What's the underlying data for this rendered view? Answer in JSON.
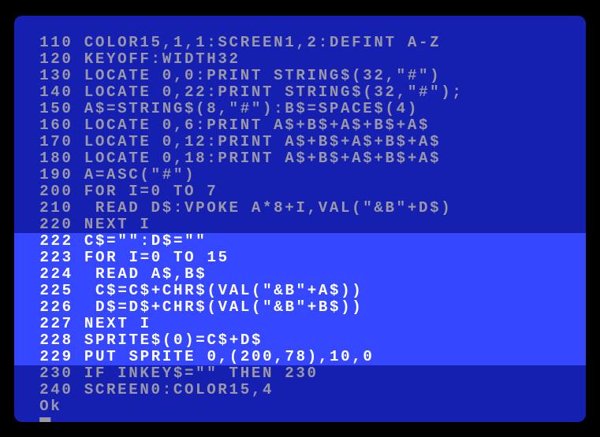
{
  "terminal": {
    "lines": [
      {
        "text": " 110 COLOR15,1,1:SCREEN1,2:DEFINT A-Z",
        "highlight": false
      },
      {
        "text": " 120 KEYOFF:WIDTH32",
        "highlight": false
      },
      {
        "text": " 130 LOCATE 0,0:PRINT STRING$(32,\"#\")",
        "highlight": false
      },
      {
        "text": " 140 LOCATE 0,22:PRINT STRING$(32,\"#\");",
        "highlight": false
      },
      {
        "text": " 150 A$=STRING$(8,\"#\"):B$=SPACE$(4)",
        "highlight": false
      },
      {
        "text": " 160 LOCATE 0,6:PRINT A$+B$+A$+B$+A$",
        "highlight": false
      },
      {
        "text": " 170 LOCATE 0,12:PRINT A$+B$+A$+B$+A$",
        "highlight": false
      },
      {
        "text": " 180 LOCATE 0,18:PRINT A$+B$+A$+B$+A$",
        "highlight": false
      },
      {
        "text": " 190 A=ASC(\"#\")",
        "highlight": false
      },
      {
        "text": " 200 FOR I=0 TO 7",
        "highlight": false
      },
      {
        "text": " 210  READ D$:VPOKE A*8+I,VAL(\"&B\"+D$)",
        "highlight": false
      },
      {
        "text": " 220 NEXT I",
        "highlight": false
      },
      {
        "text": " 222 C$=\"\":D$=\"\"",
        "highlight": true
      },
      {
        "text": " 223 FOR I=0 TO 15",
        "highlight": true
      },
      {
        "text": " 224  READ A$,B$",
        "highlight": true
      },
      {
        "text": " 225  C$=C$+CHR$(VAL(\"&B\"+A$))",
        "highlight": true
      },
      {
        "text": " 226  D$=D$+CHR$(VAL(\"&B\"+B$))",
        "highlight": true
      },
      {
        "text": " 227 NEXT I",
        "highlight": true
      },
      {
        "text": " 228 SPRITE$(0)=C$+D$",
        "highlight": true
      },
      {
        "text": " 229 PUT SPRITE 0,(200,78),10,0",
        "highlight": true
      },
      {
        "text": " 230 IF INKEY$=\"\" THEN 230",
        "highlight": false
      },
      {
        "text": " 240 SCREEN0:COLOR15,4",
        "highlight": false
      },
      {
        "text": " Ok",
        "highlight": false
      }
    ]
  }
}
